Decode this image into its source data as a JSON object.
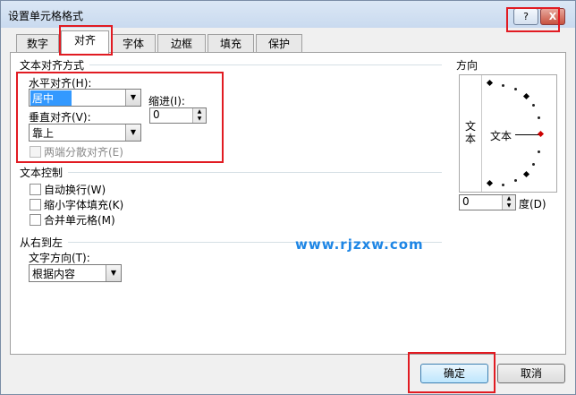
{
  "window": {
    "title": "设置单元格格式",
    "help_label": "?",
    "close_label": "X"
  },
  "tabs": [
    {
      "label": "数字"
    },
    {
      "label": "对齐"
    },
    {
      "label": "字体"
    },
    {
      "label": "边框"
    },
    {
      "label": "填充"
    },
    {
      "label": "保护"
    }
  ],
  "active_tab": "对齐",
  "text_align": {
    "section_title": "文本对齐方式",
    "horizontal_label": "水平对齐(H):",
    "horizontal_value": "居中",
    "vertical_label": "垂直对齐(V):",
    "vertical_value": "靠上",
    "indent_label": "缩进(I):",
    "indent_value": "0",
    "distributed_label": "两端分散对齐(E)"
  },
  "text_control": {
    "section_title": "文本控制",
    "wrap_label": "自动换行(W)",
    "shrink_label": "缩小字体填充(K)",
    "merge_label": "合并单元格(M)"
  },
  "rtl": {
    "section_title": "从右到左",
    "direction_label": "文字方向(T):",
    "direction_value": "根据内容"
  },
  "orientation": {
    "section_title": "方向",
    "vertical_text": "文本",
    "text_label": "文本",
    "degree_value": "0",
    "degree_label": "度(D)"
  },
  "watermark": "www.rjzxw.com",
  "buttons": {
    "ok_label": "确定",
    "cancel_label": "取消"
  },
  "icons": {
    "dropdown": "chevron-down-icon",
    "spin": "spin-arrows-icon"
  },
  "colors": {
    "highlight_red": "#e11b22",
    "watermark": "#1e86e5",
    "selection": "#3399ff"
  }
}
